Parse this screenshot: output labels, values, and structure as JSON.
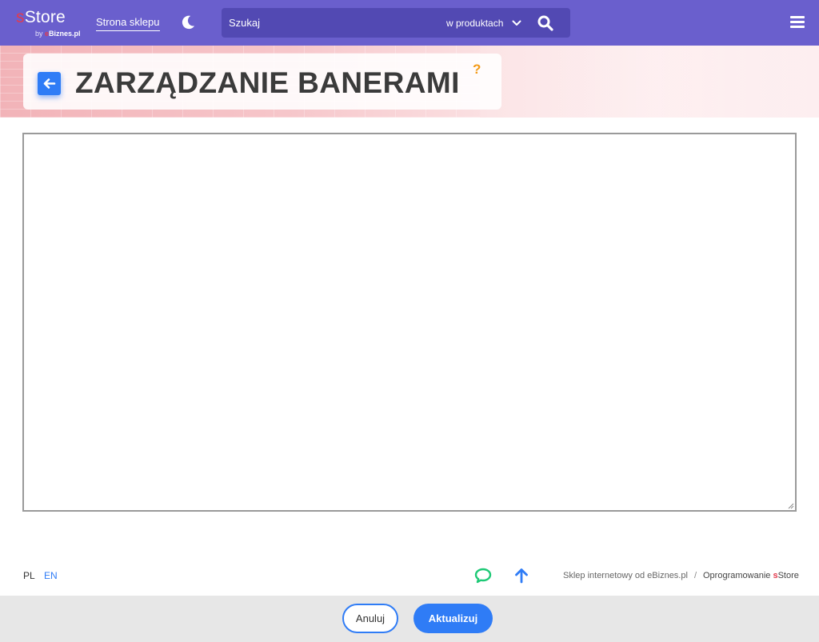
{
  "app": {
    "logo_prefix": "s",
    "logo_text": "Store",
    "logo_sub_by": "by ",
    "logo_sub_e": "e",
    "logo_sub_brand": "Biznes.pl"
  },
  "topbar": {
    "shop_link": "Strona sklepu",
    "search_placeholder": "Szukaj",
    "search_scope": "w produktach"
  },
  "header": {
    "title": "ZARZĄDZANIE BANERAMI",
    "help": "?"
  },
  "footer": {
    "lang_pl": "PL",
    "lang_en": "EN",
    "link_shop": "Sklep internetowy od eBiznes.pl",
    "separator": "/",
    "link_software_prefix": "Oprogramowanie ",
    "link_software_s": "s",
    "link_software_store": "Store"
  },
  "actions": {
    "cancel": "Anuluj",
    "update": "Aktualizuj"
  },
  "colors": {
    "topbar": "#6a5fcd",
    "search_bg": "#5249b3",
    "accent": "#2f7cf6",
    "help": "#f39a16",
    "chat": "#1ec976",
    "brand_red": "#e23b4e"
  },
  "icons": {
    "theme": "moon-icon",
    "search": "search-icon",
    "menu": "hamburger-menu-icon",
    "back": "arrow-left-icon",
    "chat": "chat-bubble-icon",
    "scroll_top": "arrow-up-icon"
  }
}
